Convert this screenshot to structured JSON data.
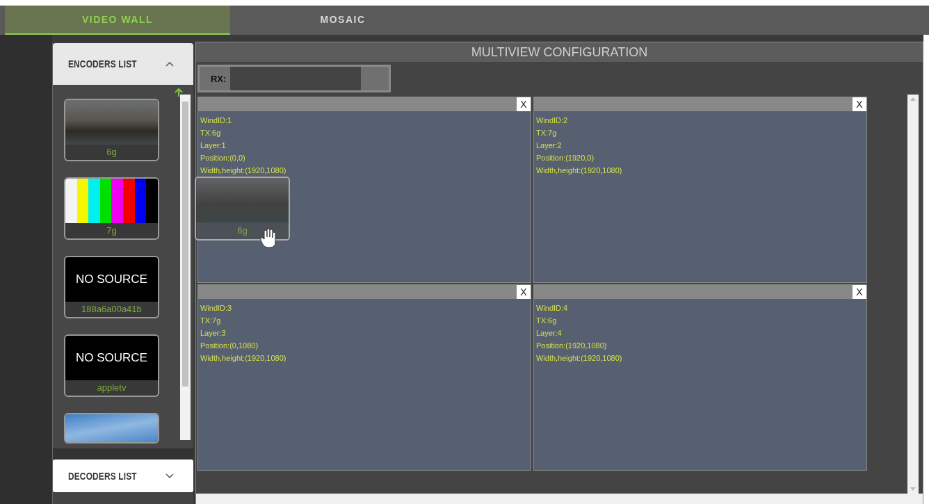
{
  "tabs": [
    {
      "label": "VIDEO WALL",
      "selected": true
    },
    {
      "label": "MOSAIC",
      "selected": false
    }
  ],
  "encoders_list": {
    "title": "ENCODERS LIST",
    "expanded": true,
    "items": [
      {
        "kind": "photo",
        "label": "6g"
      },
      {
        "kind": "color-bars",
        "label": "7g"
      },
      {
        "kind": "no-source",
        "source_text": "NO SOURCE",
        "label": "188a6a00a41b"
      },
      {
        "kind": "no-source",
        "source_text": "NO SOURCE",
        "label": "appletv"
      },
      {
        "kind": "sky"
      }
    ]
  },
  "decoders_list": {
    "title": "DECODERS LIST",
    "expanded": false
  },
  "multiview": {
    "title": "MULTIVIEW CONFIGURATION",
    "rx_label": "RX:",
    "windows": [
      {
        "close_label": "X",
        "lines": [
          "WindID:1",
          "TX:6g",
          "Layer:1",
          "Position:(0,0)",
          "Width,height:(1920,1080)"
        ]
      },
      {
        "close_label": "X",
        "lines": [
          "WindID:2",
          "TX:7g",
          "Layer:2",
          "Position:(1920,0)",
          "Width,height:(1920,1080)"
        ]
      },
      {
        "close_label": "X",
        "lines": [
          "WindID:3",
          "TX:7g",
          "Layer:3",
          "Position:(0,1080)",
          "Width,height:(1920,1080)"
        ]
      },
      {
        "close_label": "X",
        "lines": [
          "WindID:4",
          "TX:6g",
          "Layer:4",
          "Position:(1920,1080)",
          "Width,height:(1920,1080)"
        ]
      }
    ]
  },
  "drag_preview": {
    "label": "6g"
  }
}
